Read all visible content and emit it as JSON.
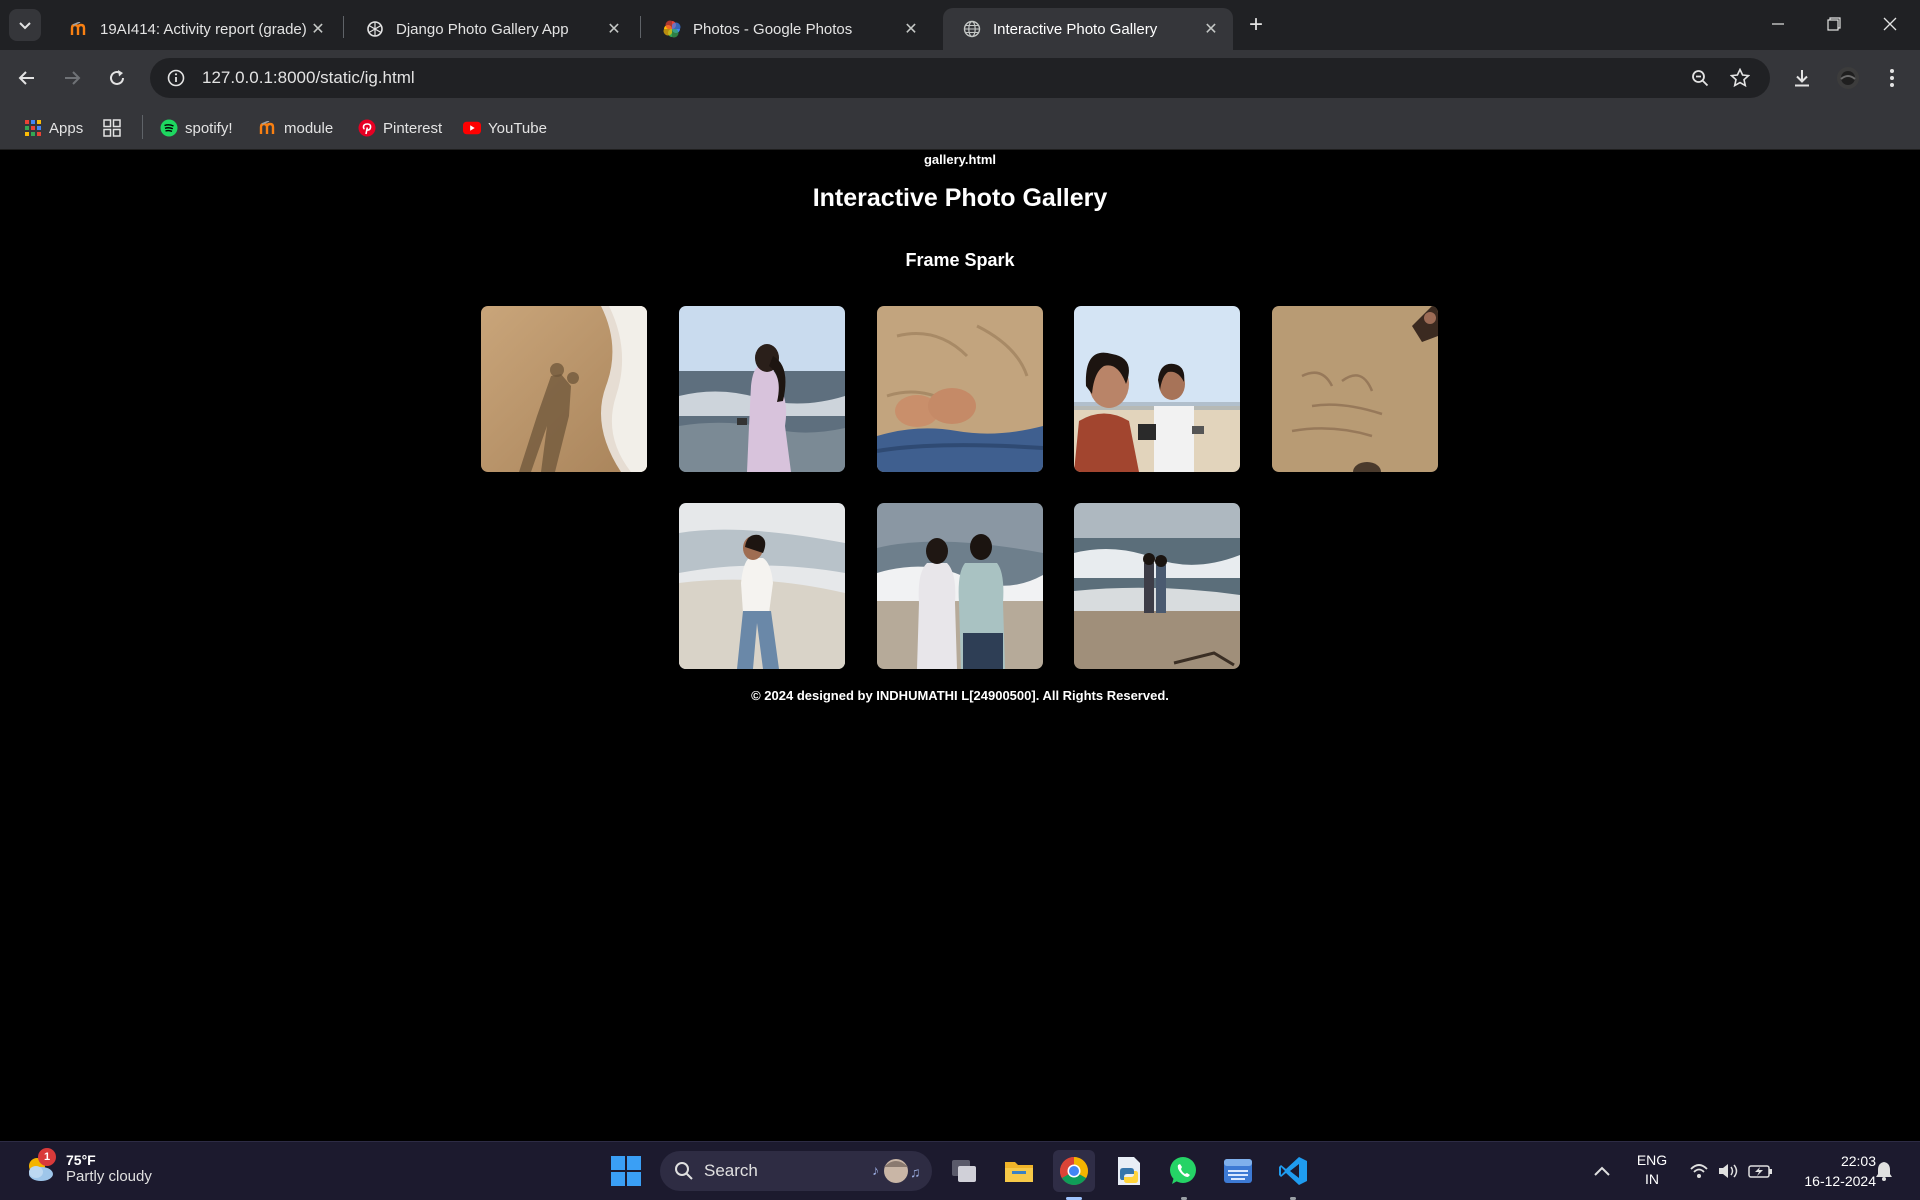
{
  "browser": {
    "tabs": [
      {
        "title": "19AI414: Activity report (grade)",
        "favicon": "moodle-m-icon",
        "active": false
      },
      {
        "title": "Django Photo Gallery App",
        "favicon": "openai-icon",
        "active": false
      },
      {
        "title": "Photos - Google Photos",
        "favicon": "google-photos-icon",
        "active": false
      },
      {
        "title": "Interactive Photo Gallery",
        "favicon": "globe-icon",
        "active": true
      }
    ],
    "url": "127.0.0.1:8000/static/ig.html",
    "bookmarks": [
      {
        "label": "Apps",
        "icon": "apps-grid-icon"
      },
      {
        "label": "",
        "icon": "tab-groups-icon"
      },
      {
        "label": "spotify!",
        "icon": "spotify-icon"
      },
      {
        "label": "module",
        "icon": "moodle-m-icon"
      },
      {
        "label": "Pinterest",
        "icon": "pinterest-icon"
      },
      {
        "label": "YouTube",
        "icon": "youtube-icon"
      }
    ]
  },
  "page": {
    "filename": "gallery.html",
    "title": "Interactive Photo Gallery",
    "subtitle": "Frame Spark",
    "photos": [
      {
        "name": "photo-shadow-beach",
        "scene": "shadows-on-wet-sand"
      },
      {
        "name": "photo-girl-sea-waves",
        "scene": "girl-at-sea"
      },
      {
        "name": "photo-feet-sand",
        "scene": "feet-in-sand"
      },
      {
        "name": "photo-two-girls-beach",
        "scene": "two-girls"
      },
      {
        "name": "photo-writing-sand",
        "scene": "writing-on-sand"
      },
      {
        "name": "photo-girl-surf",
        "scene": "girl-in-surf"
      },
      {
        "name": "photo-couple-waves",
        "scene": "couple-at-waves"
      },
      {
        "name": "photo-couple-far-shore",
        "scene": "couple-far-shore"
      }
    ],
    "footer": "© 2024 designed by INDHUMATHI L[24900500]. All Rights Reserved."
  },
  "taskbar": {
    "weather": {
      "temp": "75°F",
      "condition": "Partly cloudy",
      "badge": "1"
    },
    "search_label": "Search",
    "lang": {
      "line1": "ENG",
      "line2": "IN"
    },
    "time": "22:03",
    "date": "16-12-2024"
  },
  "colors": {
    "page_bg": "#000000",
    "chrome_dark": "#202124",
    "chrome_mid": "#35363a"
  }
}
